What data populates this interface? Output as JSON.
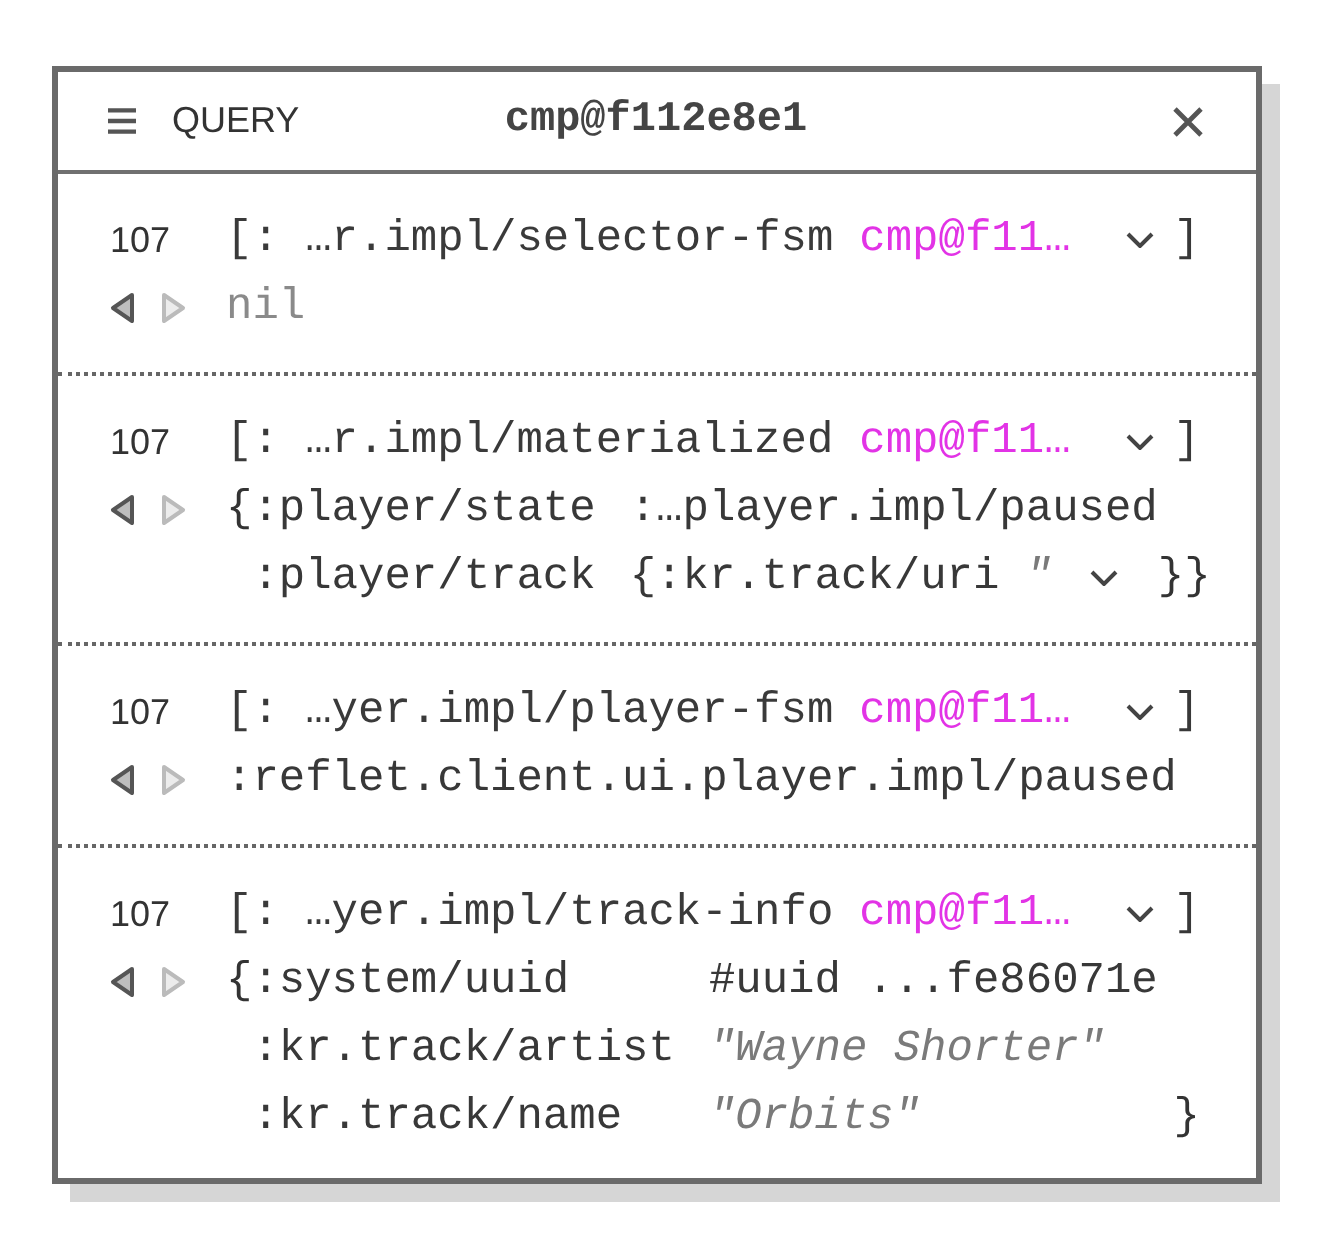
{
  "panel": {
    "menu_label": "QUERY",
    "title": "cmp@f112e8e1"
  },
  "entries": [
    {
      "count": "107",
      "back_enabled": true,
      "forward_enabled": false,
      "query": "[: …r.impl/selector-fsm",
      "component": "cmp@f11…",
      "expandable": true,
      "close": "]",
      "result": {
        "kind": "value",
        "tokens": [
          {
            "text": "nil",
            "kind": "nil"
          }
        ]
      }
    },
    {
      "count": "107",
      "back_enabled": true,
      "forward_enabled": false,
      "query": "[: …r.impl/materialized",
      "component": "cmp@f11…",
      "expandable": true,
      "close": "]",
      "result": {
        "kind": "map",
        "open": "{",
        "rows": [
          {
            "key": ":player/state",
            "value": [
              {
                "text": ":…player.impl/paused",
                "kind": "keyword"
              }
            ],
            "expandable": false
          },
          {
            "key": ":player/track",
            "value": [
              {
                "text": "{:kr.track/uri",
                "kind": "map"
              },
              {
                "text": "\"",
                "kind": "string"
              }
            ],
            "expandable": true
          }
        ],
        "close": "}}"
      }
    },
    {
      "count": "107",
      "back_enabled": true,
      "forward_enabled": false,
      "query": "[: …yer.impl/player-fsm",
      "component": "cmp@f11…",
      "expandable": true,
      "close": "]",
      "result": {
        "kind": "value",
        "tokens": [
          {
            "text": ":reflet.client.ui.player.impl/paused",
            "kind": "keyword"
          }
        ]
      }
    },
    {
      "count": "107",
      "back_enabled": true,
      "forward_enabled": false,
      "query": "[: …yer.impl/track-info",
      "component": "cmp@f11…",
      "expandable": true,
      "close": "]",
      "result": {
        "kind": "map",
        "open": "{",
        "rows": [
          {
            "key": ":system/uuid",
            "value": [
              {
                "text": "#uuid ...fe86071e",
                "kind": "tagged"
              }
            ],
            "expandable": false
          },
          {
            "key": ":kr.track/artist",
            "value": [
              {
                "text": "\"Wayne Shorter\"",
                "kind": "string"
              }
            ],
            "expandable": false
          },
          {
            "key": ":kr.track/name",
            "value": [
              {
                "text": "\"Orbits\"",
                "kind": "string"
              }
            ],
            "expandable": false
          }
        ],
        "close": "}"
      }
    }
  ]
}
